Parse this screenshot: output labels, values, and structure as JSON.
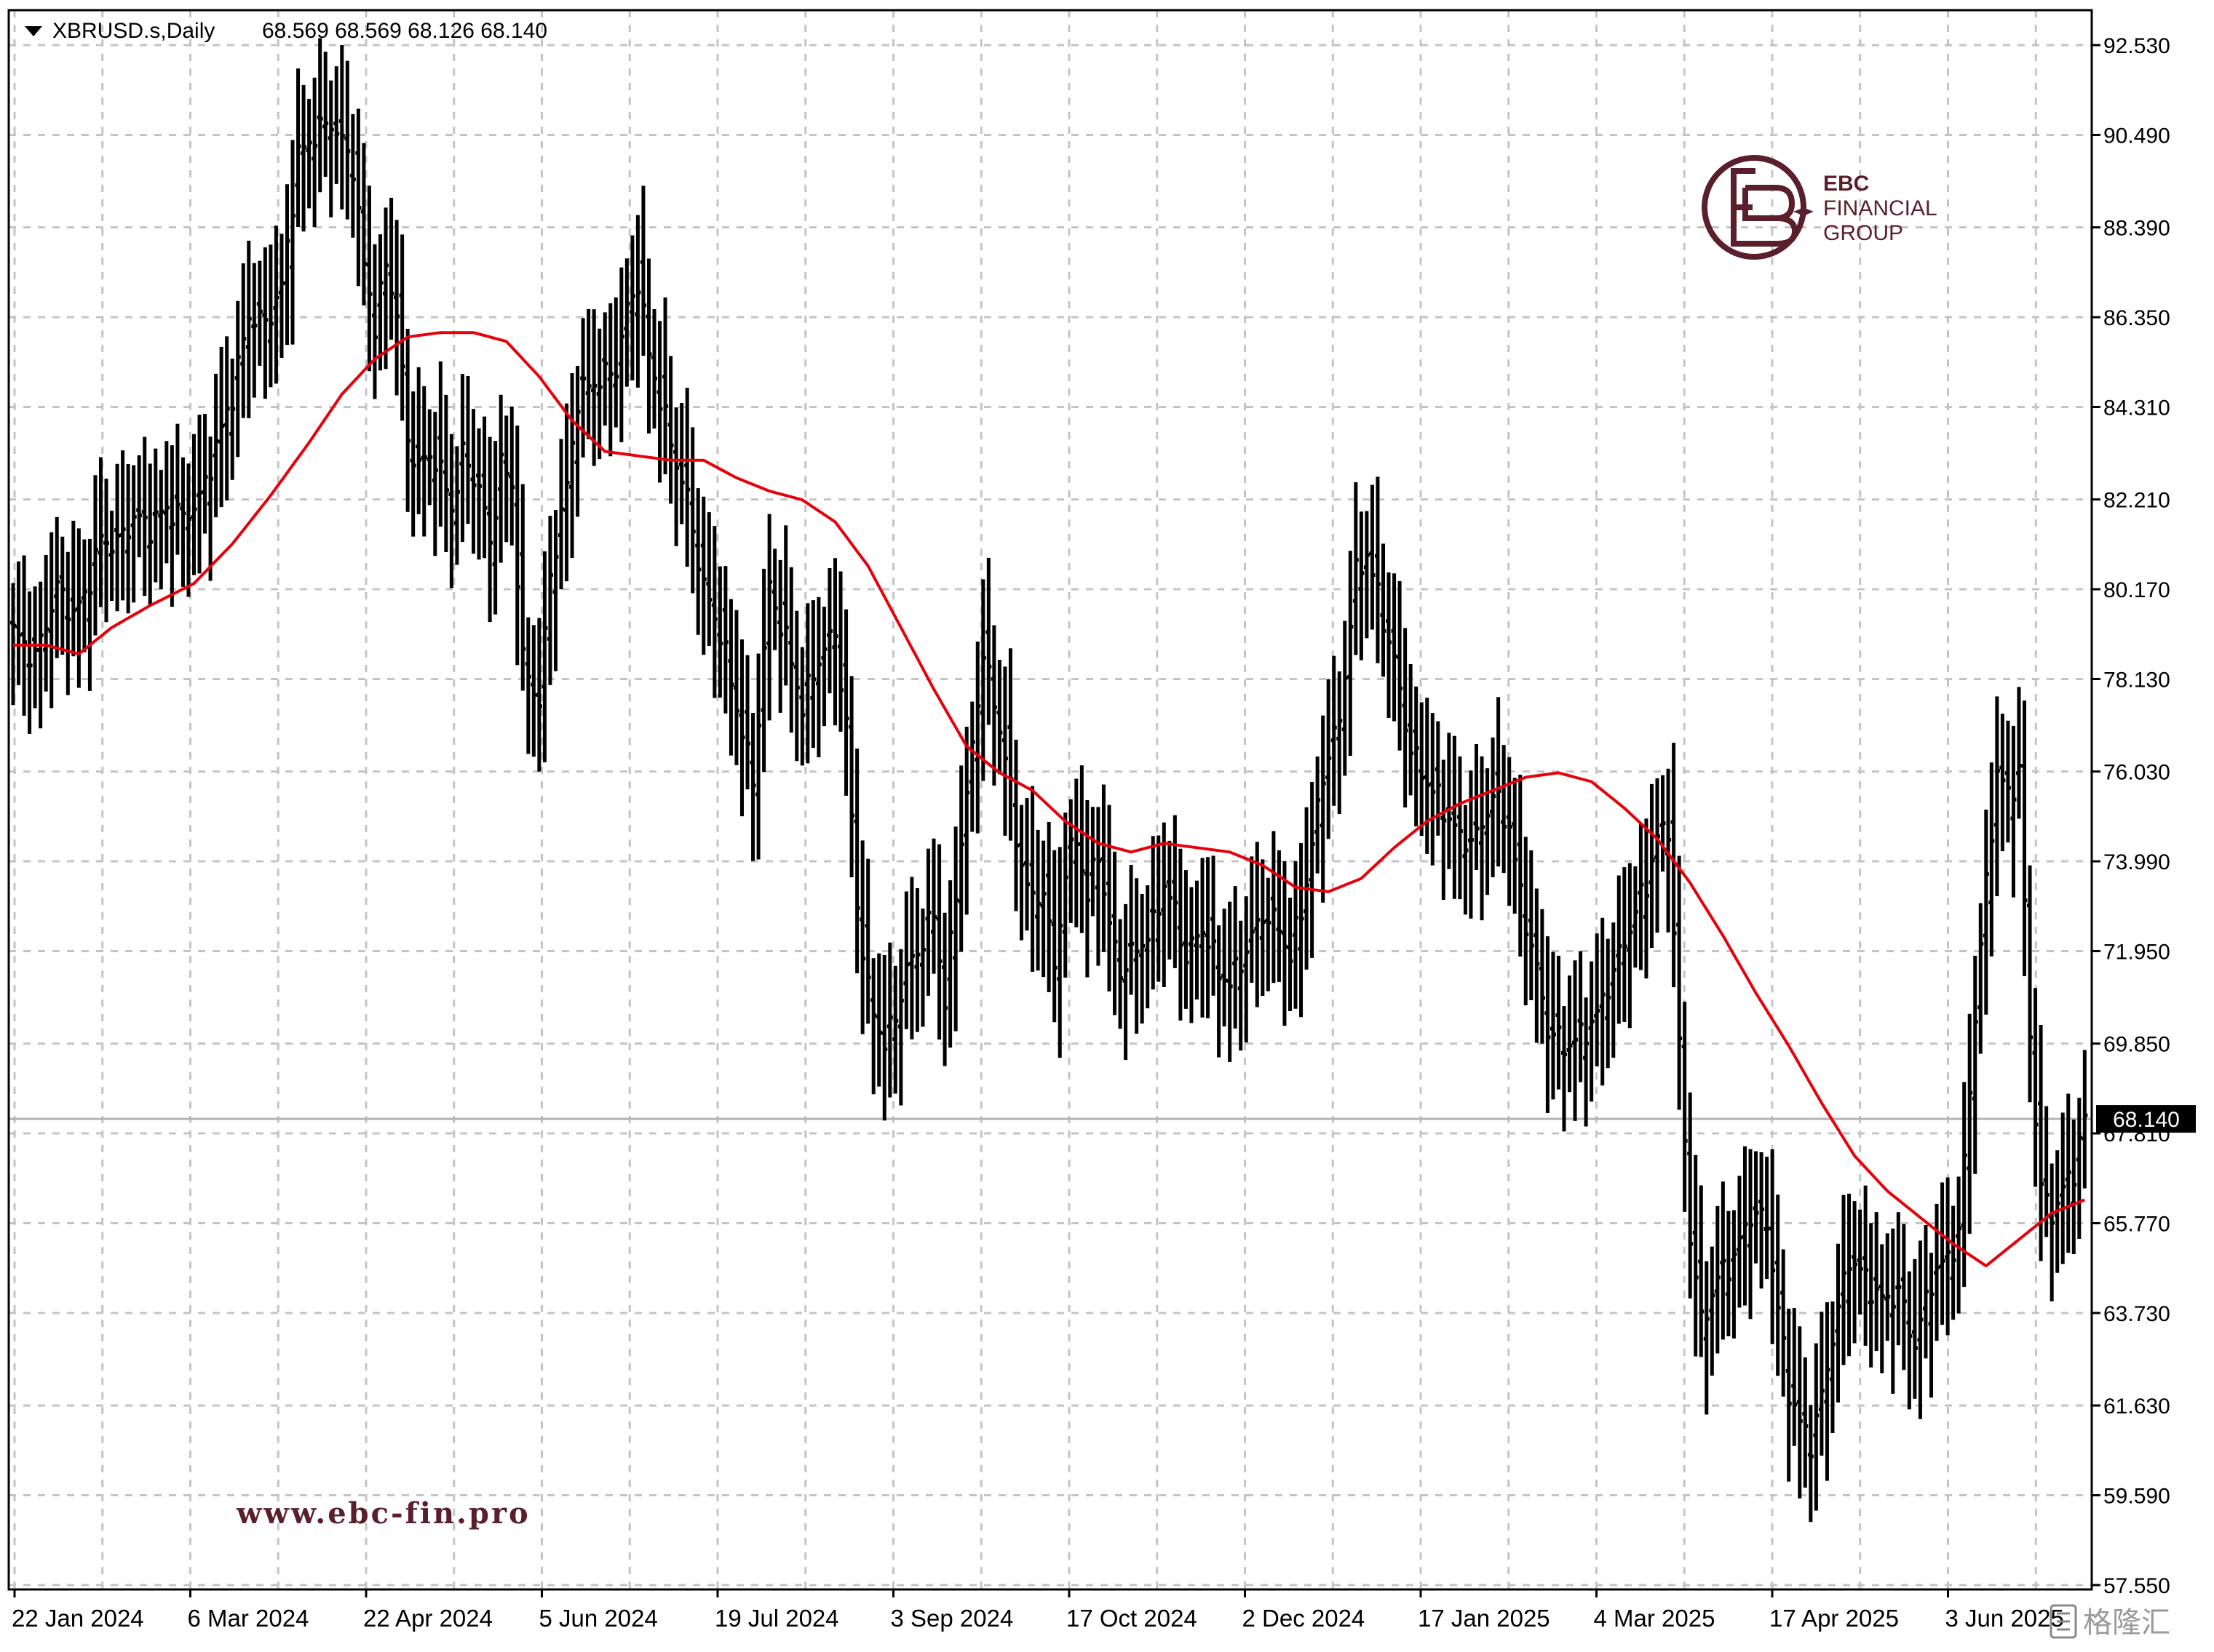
{
  "header": {
    "symbol": "XBRUSD.s,Daily",
    "ohlc": "68.569 68.569 68.126 68.140"
  },
  "brand": {
    "logo_line1": "EBC",
    "logo_line2": "FINANCIAL",
    "logo_line3": "GROUP",
    "watermark_url": "www.ebc-fin.pro",
    "corner_mark": "格隆汇",
    "color": "#5a1f2a"
  },
  "colors": {
    "bars": "#000000",
    "ma": "#e8000b",
    "grid": "#c4c4c4",
    "last_price_line": "#b4b4b4"
  },
  "chart_data": {
    "type": "ohlc",
    "y_ticks": [
      "92.530",
      "90.490",
      "88.390",
      "86.350",
      "84.310",
      "82.210",
      "80.170",
      "78.130",
      "76.030",
      "73.990",
      "71.950",
      "69.850",
      "67.810",
      "65.770",
      "63.730",
      "61.630",
      "59.590",
      "57.550"
    ],
    "ylim": [
      57.55,
      92.53
    ],
    "x_ticks": [
      "22 Jan 2024",
      "6 Mar 2024",
      "22 Apr 2024",
      "5 Jun 2024",
      "19 Jul 2024",
      "3 Sep 2024",
      "17 Oct 2024",
      "2 Dec 2024",
      "17 Jan 2025",
      "4 Mar 2025",
      "17 Apr 2025",
      "3 Jun 2025"
    ],
    "last_price": "68.140",
    "close_anchors": [
      [
        0,
        79.2
      ],
      [
        4,
        78.6
      ],
      [
        8,
        80.2
      ],
      [
        11,
        79.6
      ],
      [
        13,
        80.0
      ],
      [
        16,
        81.3
      ],
      [
        19,
        81.2
      ],
      [
        22,
        81.8
      ],
      [
        25,
        81.6
      ],
      [
        28,
        82.0
      ],
      [
        31,
        81.8
      ],
      [
        34,
        82.2
      ],
      [
        37,
        83.4
      ],
      [
        40,
        84.6
      ],
      [
        43,
        86.4
      ],
      [
        46,
        86.2
      ],
      [
        49,
        87.0
      ],
      [
        52,
        90.0
      ],
      [
        55,
        90.5
      ],
      [
        58,
        90.8
      ],
      [
        62,
        89.8
      ],
      [
        64,
        87.5
      ],
      [
        66,
        86.2
      ],
      [
        68,
        87.5
      ],
      [
        70,
        86.5
      ],
      [
        72,
        83.5
      ],
      [
        74,
        83.0
      ],
      [
        77,
        83.2
      ],
      [
        80,
        82.0
      ],
      [
        82,
        83.2
      ],
      [
        85,
        82.5
      ],
      [
        87,
        81.2
      ],
      [
        89,
        83.0
      ],
      [
        91,
        82.5
      ],
      [
        93,
        78.5
      ],
      [
        96,
        77.6
      ],
      [
        98,
        80.5
      ],
      [
        101,
        82.5
      ],
      [
        103,
        84.5
      ],
      [
        105,
        84.8
      ],
      [
        108,
        85.0
      ],
      [
        110,
        85.2
      ],
      [
        112,
        86.5
      ],
      [
        114,
        87.2
      ],
      [
        116,
        85.5
      ],
      [
        118,
        84.5
      ],
      [
        120,
        83.5
      ],
      [
        123,
        82.2
      ],
      [
        126,
        80.2
      ],
      [
        129,
        79.2
      ],
      [
        132,
        77.5
      ],
      [
        135,
        75.8
      ],
      [
        138,
        80.2
      ],
      [
        141,
        79.0
      ],
      [
        144,
        77.5
      ],
      [
        147,
        78.6
      ],
      [
        150,
        79.2
      ],
      [
        152,
        77.0
      ],
      [
        154,
        73.0
      ],
      [
        156,
        71.0
      ],
      [
        159,
        69.8
      ],
      [
        161,
        70.5
      ],
      [
        163,
        71.5
      ],
      [
        166,
        72.2
      ],
      [
        168,
        72.8
      ],
      [
        170,
        70.8
      ],
      [
        173,
        74.5
      ],
      [
        175,
        76.5
      ],
      [
        177,
        78.8
      ],
      [
        179,
        77.5
      ],
      [
        181,
        76.5
      ],
      [
        183,
        74.5
      ],
      [
        186,
        73.0
      ],
      [
        188,
        73.4
      ],
      [
        190,
        71.5
      ],
      [
        192,
        73.8
      ],
      [
        194,
        74.5
      ],
      [
        196,
        73.2
      ],
      [
        198,
        74.2
      ],
      [
        200,
        72.5
      ],
      [
        202,
        71.5
      ],
      [
        205,
        72.0
      ],
      [
        208,
        72.5
      ],
      [
        210,
        73.5
      ],
      [
        212,
        72.8
      ],
      [
        214,
        71.8
      ],
      [
        217,
        72.5
      ],
      [
        220,
        71.5
      ],
      [
        222,
        71.2
      ],
      [
        225,
        72.0
      ],
      [
        228,
        72.8
      ],
      [
        231,
        72.5
      ],
      [
        233,
        71.8
      ],
      [
        236,
        73.5
      ],
      [
        239,
        76.0
      ],
      [
        242,
        77.2
      ],
      [
        245,
        80.5
      ],
      [
        247,
        81.0
      ],
      [
        249,
        80.0
      ],
      [
        252,
        78.5
      ],
      [
        255,
        76.5
      ],
      [
        258,
        75.8
      ],
      [
        261,
        75.2
      ],
      [
        264,
        74.5
      ],
      [
        267,
        74.5
      ],
      [
        270,
        75.5
      ],
      [
        273,
        74.8
      ],
      [
        275,
        73.2
      ],
      [
        278,
        71.5
      ],
      [
        280,
        70.2
      ],
      [
        283,
        69.8
      ],
      [
        286,
        70.0
      ],
      [
        289,
        70.5
      ],
      [
        292,
        71.5
      ],
      [
        295,
        72.5
      ],
      [
        298,
        73.5
      ],
      [
        300,
        74.5
      ],
      [
        302,
        74.8
      ],
      [
        304,
        69.8
      ],
      [
        306,
        65.5
      ],
      [
        308,
        63.5
      ],
      [
        311,
        64.5
      ],
      [
        314,
        65.0
      ],
      [
        317,
        66.0
      ],
      [
        320,
        65.8
      ],
      [
        322,
        63.8
      ],
      [
        324,
        62.0
      ],
      [
        326,
        61.2
      ],
      [
        328,
        60.8
      ],
      [
        330,
        61.8
      ],
      [
        332,
        63.2
      ],
      [
        335,
        65.0
      ],
      [
        338,
        64.5
      ],
      [
        341,
        64.0
      ],
      [
        344,
        64.2
      ],
      [
        347,
        63.0
      ],
      [
        350,
        64.5
      ],
      [
        353,
        65.0
      ],
      [
        355,
        65.5
      ],
      [
        358,
        70.5
      ],
      [
        360,
        73.5
      ],
      [
        362,
        76.0
      ],
      [
        364,
        75.5
      ],
      [
        366,
        76.0
      ],
      [
        368,
        70.0
      ],
      [
        370,
        66.5
      ],
      [
        372,
        66.0
      ],
      [
        374,
        66.5
      ],
      [
        376,
        67.0
      ],
      [
        378,
        68.14
      ]
    ],
    "ma_anchors": [
      [
        0,
        78.9
      ],
      [
        6,
        78.9
      ],
      [
        12,
        78.7
      ],
      [
        18,
        79.3
      ],
      [
        25,
        79.8
      ],
      [
        33,
        80.3
      ],
      [
        40,
        81.2
      ],
      [
        47,
        82.3
      ],
      [
        54,
        83.5
      ],
      [
        60,
        84.6
      ],
      [
        66,
        85.4
      ],
      [
        72,
        85.9
      ],
      [
        78,
        86.0
      ],
      [
        84,
        86.0
      ],
      [
        90,
        85.8
      ],
      [
        96,
        85.0
      ],
      [
        102,
        84.0
      ],
      [
        108,
        83.3
      ],
      [
        114,
        83.2
      ],
      [
        120,
        83.1
      ],
      [
        126,
        83.1
      ],
      [
        132,
        82.7
      ],
      [
        138,
        82.4
      ],
      [
        144,
        82.2
      ],
      [
        150,
        81.7
      ],
      [
        156,
        80.7
      ],
      [
        162,
        79.3
      ],
      [
        168,
        77.9
      ],
      [
        174,
        76.6
      ],
      [
        180,
        76.0
      ],
      [
        186,
        75.6
      ],
      [
        192,
        74.9
      ],
      [
        198,
        74.4
      ],
      [
        204,
        74.2
      ],
      [
        210,
        74.4
      ],
      [
        216,
        74.3
      ],
      [
        222,
        74.2
      ],
      [
        228,
        73.9
      ],
      [
        234,
        73.4
      ],
      [
        240,
        73.3
      ],
      [
        246,
        73.6
      ],
      [
        252,
        74.3
      ],
      [
        258,
        74.9
      ],
      [
        264,
        75.3
      ],
      [
        270,
        75.6
      ],
      [
        276,
        75.9
      ],
      [
        282,
        76.0
      ],
      [
        288,
        75.8
      ],
      [
        294,
        75.2
      ],
      [
        300,
        74.5
      ],
      [
        306,
        73.5
      ],
      [
        312,
        72.3
      ],
      [
        318,
        71.0
      ],
      [
        324,
        69.8
      ],
      [
        330,
        68.5
      ],
      [
        336,
        67.3
      ],
      [
        342,
        66.5
      ],
      [
        348,
        65.9
      ],
      [
        354,
        65.3
      ],
      [
        360,
        64.8
      ],
      [
        366,
        65.4
      ],
      [
        372,
        66.0
      ],
      [
        378,
        66.3
      ]
    ]
  }
}
